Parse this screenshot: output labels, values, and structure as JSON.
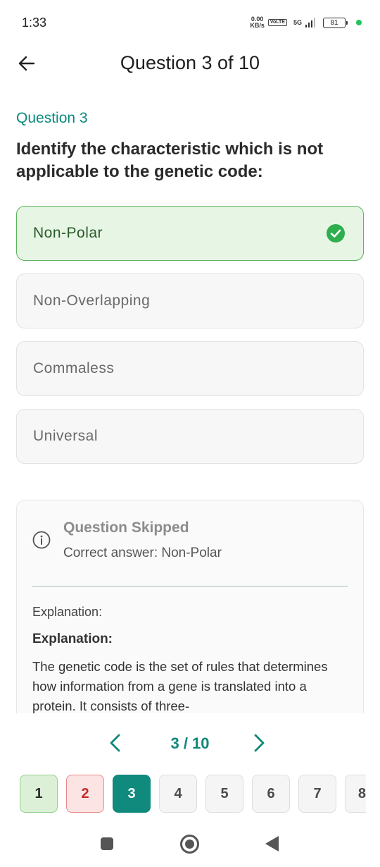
{
  "status_bar": {
    "time": "1:33",
    "net_speed_value": "0.00",
    "net_speed_unit": "KB/s",
    "volte": "VoLTE",
    "network": "5G",
    "battery": "81"
  },
  "header": {
    "title": "Question 3 of 10"
  },
  "question": {
    "label": "Question 3",
    "text": "Identify the characteristic which is not applicable to the genetic code:"
  },
  "options": [
    {
      "label": "Non-Polar",
      "correct": true
    },
    {
      "label": "Non-Overlapping",
      "correct": false
    },
    {
      "label": "Commaless",
      "correct": false
    },
    {
      "label": "Universal",
      "correct": false
    }
  ],
  "info": {
    "title": "Question Skipped",
    "correct_answer": "Correct answer: Non-Polar",
    "explanation_label": "Explanation:",
    "explanation_heading": "Explanation:",
    "explanation_text": "The genetic code is the set of rules that determines how information from a gene is translated into a protein. It consists of three-"
  },
  "pager": {
    "indicator": "3 / 10",
    "numbers": [
      "1",
      "2",
      "3",
      "4",
      "5",
      "6",
      "7",
      "8"
    ]
  },
  "colors": {
    "accent": "#0f8a7c",
    "correct_bg": "#e7f5e4",
    "correct_border": "#5cb35a",
    "check_green": "#2fae4e"
  }
}
